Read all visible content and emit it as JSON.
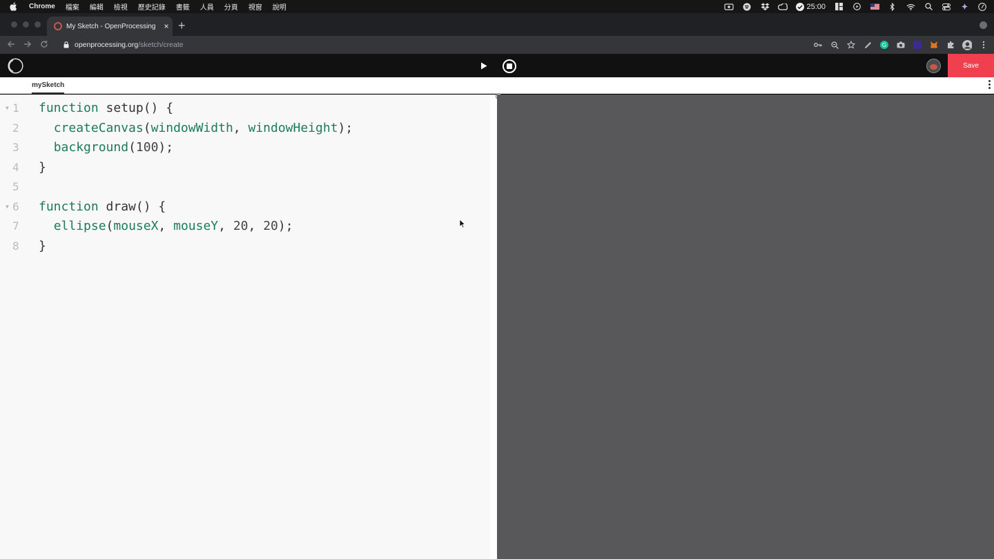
{
  "menubar": {
    "app_name": "Chrome",
    "items": [
      "檔案",
      "編輯",
      "檢視",
      "歷史記錄",
      "書籤",
      "人員",
      "分頁",
      "視窗",
      "說明"
    ],
    "timer": "25:00"
  },
  "browser": {
    "tab_title": "My Sketch - OpenProcessing",
    "tab_close": "×",
    "new_tab": "+",
    "url_host": "openprocessing.org",
    "url_path": "/sketch/create"
  },
  "openprocessing": {
    "save_label": "Save",
    "file_tab": "mySketch"
  },
  "editor": {
    "lines": [
      {
        "num": "1",
        "fold": "▼",
        "parts": [
          [
            "kw",
            "function"
          ],
          [
            "txt",
            " setup() {"
          ]
        ]
      },
      {
        "num": "2",
        "fold": "",
        "parts": [
          [
            "txt",
            "  "
          ],
          [
            "fn",
            "createCanvas"
          ],
          [
            "txt",
            "("
          ],
          [
            "arg",
            "windowWidth"
          ],
          [
            "txt",
            ", "
          ],
          [
            "arg",
            "windowHeight"
          ],
          [
            "txt",
            ");"
          ]
        ]
      },
      {
        "num": "3",
        "fold": "",
        "parts": [
          [
            "txt",
            "  "
          ],
          [
            "fn",
            "background"
          ],
          [
            "txt",
            "("
          ],
          [
            "num",
            "100"
          ],
          [
            "txt",
            ");"
          ]
        ]
      },
      {
        "num": "4",
        "fold": "",
        "parts": [
          [
            "txt",
            "}"
          ]
        ]
      },
      {
        "num": "5",
        "fold": "",
        "parts": [
          [
            "txt",
            ""
          ]
        ]
      },
      {
        "num": "6",
        "fold": "▼",
        "parts": [
          [
            "kw",
            "function"
          ],
          [
            "txt",
            " draw() {"
          ]
        ]
      },
      {
        "num": "7",
        "fold": "",
        "parts": [
          [
            "txt",
            "  "
          ],
          [
            "fn",
            "ellipse"
          ],
          [
            "txt",
            "("
          ],
          [
            "arg",
            "mouseX"
          ],
          [
            "txt",
            ", "
          ],
          [
            "arg",
            "mouseY"
          ],
          [
            "txt",
            ", "
          ],
          [
            "num",
            "20"
          ],
          [
            "txt",
            ", "
          ],
          [
            "num",
            "20"
          ],
          [
            "txt",
            ");"
          ]
        ]
      },
      {
        "num": "8",
        "fold": "",
        "parts": [
          [
            "txt",
            "}"
          ]
        ]
      }
    ]
  },
  "colors": {
    "save_button": "#f0404f",
    "preview_canvas": "#58575a",
    "code_identifier": "#1c7a5a"
  }
}
